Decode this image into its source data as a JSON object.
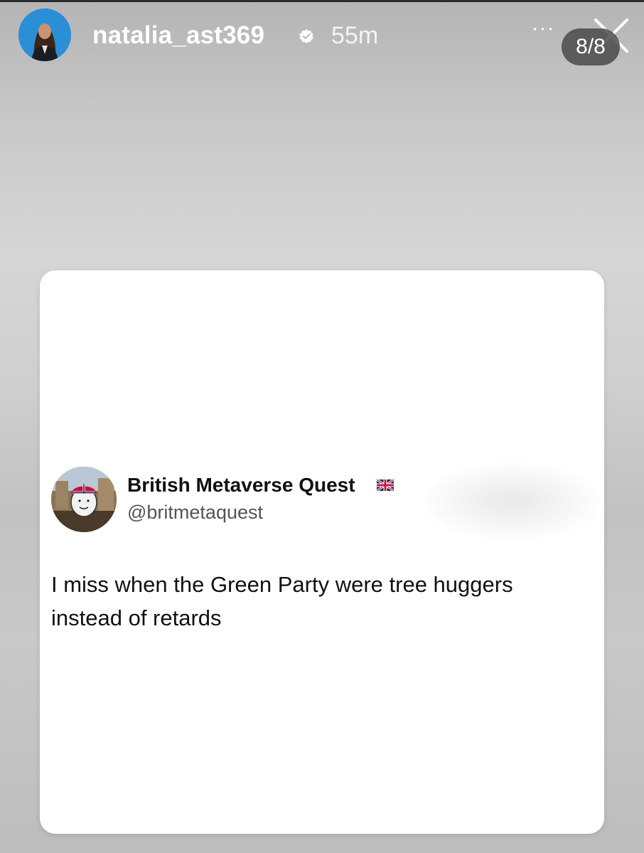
{
  "story": {
    "username": "natalia_ast369",
    "timestamp": "55m",
    "counter": "8/8",
    "more_label": "···"
  },
  "tweet": {
    "display_name": "British Metaverse Quest",
    "handle": "@britmetaquest",
    "text": "I miss when the Green Party were tree huggers instead of retards"
  },
  "icons": {
    "verified": "verified-badge-icon",
    "flag": "uk-flag-icon",
    "close": "close-icon",
    "more": "more-options-icon"
  },
  "colors": {
    "story_ring": "#2a8fd6",
    "badge_bg": "#464646",
    "card_bg": "#ffffff",
    "text_primary": "#111111",
    "text_secondary": "#555555"
  }
}
